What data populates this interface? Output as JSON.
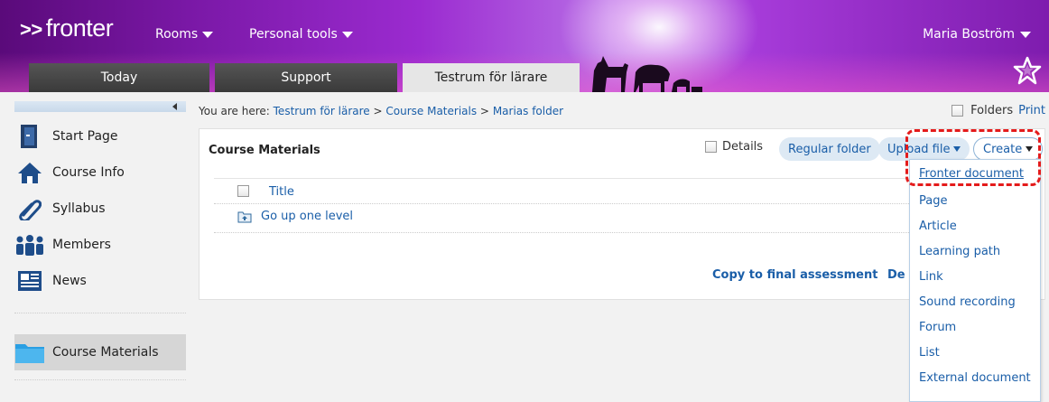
{
  "header": {
    "logo_arrows": ">>",
    "logo_text": "fronter",
    "menus": [
      {
        "label": "Rooms"
      },
      {
        "label": "Personal tools"
      }
    ],
    "user_name": "Maria Boström",
    "tabs": [
      {
        "label": "Today"
      },
      {
        "label": "Support"
      },
      {
        "label": "Testrum för lärare"
      }
    ]
  },
  "sidebar": {
    "items": [
      {
        "label": "Start Page",
        "icon": "door-icon"
      },
      {
        "label": "Course Info",
        "icon": "house-icon"
      },
      {
        "label": "Syllabus",
        "icon": "paperclip-icon"
      },
      {
        "label": "Members",
        "icon": "people-icon"
      },
      {
        "label": "News",
        "icon": "newspaper-icon"
      },
      {
        "label": "Course Materials",
        "icon": "folder-icon"
      }
    ]
  },
  "breadcrumb": {
    "prefix": "You are here:",
    "parts": [
      "Testrum för lärare",
      "Course Materials",
      "Marias folder"
    ],
    "separator": ">"
  },
  "top_right": {
    "folders_label": "Folders",
    "print_label": "Print"
  },
  "panel": {
    "title": "Course Materials",
    "details_label": "Details",
    "regular_folder": "Regular folder",
    "upload_file": "Upload file",
    "create": "Create",
    "column_title": "Title",
    "go_up": "Go up one level",
    "copy_final": "Copy to final assessment",
    "de_fragment": "De"
  },
  "create_menu": {
    "items": [
      "Fronter document",
      "Page",
      "Article",
      "Learning path",
      "Link",
      "Sound recording",
      "Forum",
      "List",
      "External document"
    ]
  },
  "colors": {
    "header_purple": "#9b2bd0",
    "link_blue": "#1a5ea8",
    "highlight_red": "#e41b1b"
  }
}
